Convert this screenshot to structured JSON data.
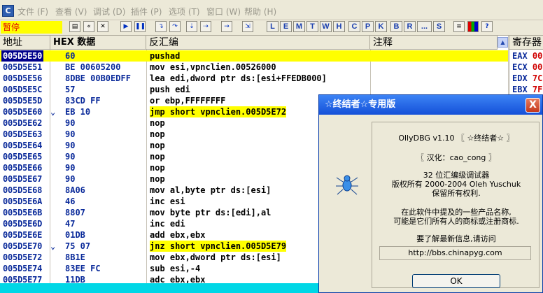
{
  "menu": {
    "items": [
      "文件 (F)",
      "查看 (V)",
      "调试 (D)",
      "插件 (P)",
      "选项 (T)",
      "窗口 (W)",
      "帮助 (H)"
    ]
  },
  "toolbar": {
    "status": "暂停",
    "letter_buttons": [
      "L",
      "E",
      "M",
      "T",
      "W",
      "H",
      "C",
      "P",
      "K",
      "B",
      "R",
      "...",
      "S"
    ]
  },
  "columns": {
    "address": "地址",
    "hex": "HEX 数据",
    "disassembly": "反汇编",
    "comment": "注释"
  },
  "rows": [
    {
      "addr": "005D5E50",
      "mark": "",
      "hex": "60",
      "asm": "pushad",
      "hl": false
    },
    {
      "addr": "005D5E51",
      "mark": "",
      "hex": "BE 00605200",
      "asm": "mov esi,vpnclien.00526000",
      "hl": false
    },
    {
      "addr": "005D5E56",
      "mark": "",
      "hex": "8DBE 00B0EDFF",
      "asm": "lea edi,dword ptr ds:[esi+FFEDB000]",
      "hl": false
    },
    {
      "addr": "005D5E5C",
      "mark": "",
      "hex": "57",
      "asm": "push edi",
      "hl": false
    },
    {
      "addr": "005D5E5D",
      "mark": "",
      "hex": "83CD FF",
      "asm": "or ebp,FFFFFFFF",
      "hl": false
    },
    {
      "addr": "005D5E60",
      "mark": "⌄",
      "hex": "EB 10",
      "asm": "jmp short vpnclien.005D5E72",
      "hl": true
    },
    {
      "addr": "005D5E62",
      "mark": "",
      "hex": "90",
      "asm": "nop",
      "hl": false
    },
    {
      "addr": "005D5E63",
      "mark": "",
      "hex": "90",
      "asm": "nop",
      "hl": false
    },
    {
      "addr": "005D5E64",
      "mark": "",
      "hex": "90",
      "asm": "nop",
      "hl": false
    },
    {
      "addr": "005D5E65",
      "mark": "",
      "hex": "90",
      "asm": "nop",
      "hl": false
    },
    {
      "addr": "005D5E66",
      "mark": "",
      "hex": "90",
      "asm": "nop",
      "hl": false
    },
    {
      "addr": "005D5E67",
      "mark": "",
      "hex": "90",
      "asm": "nop",
      "hl": false
    },
    {
      "addr": "005D5E68",
      "mark": "",
      "hex": "8A06",
      "asm": "mov al,byte ptr ds:[esi]",
      "hl": false
    },
    {
      "addr": "005D5E6A",
      "mark": "",
      "hex": "46",
      "asm": "inc esi",
      "hl": false
    },
    {
      "addr": "005D5E6B",
      "mark": "",
      "hex": "8807",
      "asm": "mov byte ptr ds:[edi],al",
      "hl": false
    },
    {
      "addr": "005D5E6D",
      "mark": "",
      "hex": "47",
      "asm": "inc edi",
      "hl": false
    },
    {
      "addr": "005D5E6E",
      "mark": "",
      "hex": "01DB",
      "asm": "add ebx,ebx",
      "hl": false
    },
    {
      "addr": "005D5E70",
      "mark": "⌄",
      "hex": "75 07",
      "asm": "jnz short vpnclien.005D5E79",
      "hl": true
    },
    {
      "addr": "005D5E72",
      "mark": "",
      "hex": "8B1E",
      "asm": "mov ebx,dword ptr ds:[esi]",
      "hl": false
    },
    {
      "addr": "005D5E74",
      "mark": "",
      "hex": "83EE FC",
      "asm": "sub esi,-4",
      "hl": false
    },
    {
      "addr": "005D5E77",
      "mark": "",
      "hex": "11DB",
      "asm": "adc ebx,ebx",
      "hl": false
    }
  ],
  "registers": {
    "title": "寄存器",
    "items": [
      {
        "name": "EAX",
        "val": "00"
      },
      {
        "name": "ECX",
        "val": "00"
      },
      {
        "name": "EDX",
        "val": "7C"
      },
      {
        "name": "EBX",
        "val": "7F"
      }
    ]
  },
  "dialog": {
    "title": "☆终结者☆专用版",
    "close": "X",
    "line1": "OllyDBG v1.10 〖 ☆终结者☆ 〗",
    "line2": "〖 汉化：cao_cong 〗",
    "line3": "32 位汇编级调试器",
    "line4": "版权所有 2000-2004 Oleh Yuschuk",
    "line5": "保留所有权利.",
    "line6": "在此软件中提及的一些产品名称,",
    "line7": "可能是它们所有人的商标或注册商标.",
    "line8": "要了解最新信息,请访问",
    "url": "http://bbs.chinapyg.com",
    "ok": "OK"
  }
}
